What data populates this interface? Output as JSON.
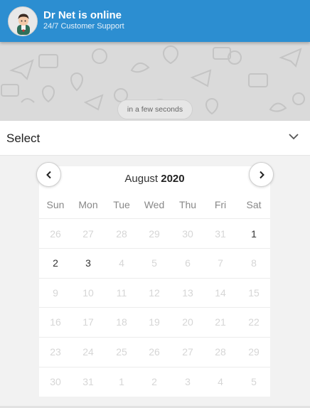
{
  "header": {
    "title": "Dr Net is online",
    "subtitle": "24/7 Customer Support",
    "color": "#2c8ed1"
  },
  "chat": {
    "timestamp": "in a few seconds"
  },
  "select": {
    "label": "Select"
  },
  "calendar": {
    "month": "August",
    "year": "2020",
    "weekdays": [
      "Sun",
      "Mon",
      "Tue",
      "Wed",
      "Thu",
      "Fri",
      "Sat"
    ],
    "weeks": [
      [
        {
          "d": "26",
          "on": false
        },
        {
          "d": "27",
          "on": false
        },
        {
          "d": "28",
          "on": false
        },
        {
          "d": "29",
          "on": false
        },
        {
          "d": "30",
          "on": false
        },
        {
          "d": "31",
          "on": false
        },
        {
          "d": "1",
          "on": true
        }
      ],
      [
        {
          "d": "2",
          "on": true
        },
        {
          "d": "3",
          "on": true
        },
        {
          "d": "4",
          "on": false
        },
        {
          "d": "5",
          "on": false
        },
        {
          "d": "6",
          "on": false
        },
        {
          "d": "7",
          "on": false
        },
        {
          "d": "8",
          "on": false
        }
      ],
      [
        {
          "d": "9",
          "on": false
        },
        {
          "d": "10",
          "on": false
        },
        {
          "d": "11",
          "on": false
        },
        {
          "d": "12",
          "on": false
        },
        {
          "d": "13",
          "on": false
        },
        {
          "d": "14",
          "on": false
        },
        {
          "d": "15",
          "on": false
        }
      ],
      [
        {
          "d": "16",
          "on": false
        },
        {
          "d": "17",
          "on": false
        },
        {
          "d": "18",
          "on": false
        },
        {
          "d": "19",
          "on": false
        },
        {
          "d": "20",
          "on": false
        },
        {
          "d": "21",
          "on": false
        },
        {
          "d": "22",
          "on": false
        }
      ],
      [
        {
          "d": "23",
          "on": false
        },
        {
          "d": "24",
          "on": false
        },
        {
          "d": "25",
          "on": false
        },
        {
          "d": "26",
          "on": false
        },
        {
          "d": "27",
          "on": false
        },
        {
          "d": "28",
          "on": false
        },
        {
          "d": "29",
          "on": false
        }
      ],
      [
        {
          "d": "30",
          "on": false
        },
        {
          "d": "31",
          "on": false
        },
        {
          "d": "1",
          "on": false
        },
        {
          "d": "2",
          "on": false
        },
        {
          "d": "3",
          "on": false
        },
        {
          "d": "4",
          "on": false
        },
        {
          "d": "5",
          "on": false
        }
      ]
    ]
  }
}
